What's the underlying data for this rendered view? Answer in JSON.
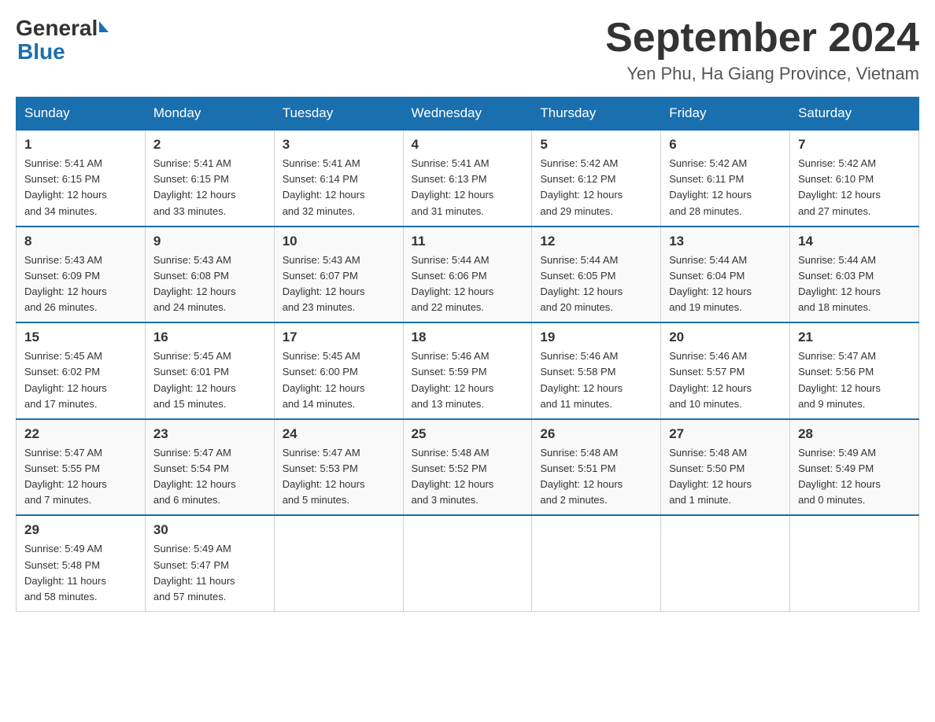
{
  "header": {
    "logo": {
      "general": "General",
      "blue": "Blue"
    },
    "title": "September 2024",
    "subtitle": "Yen Phu, Ha Giang Province, Vietnam"
  },
  "weekdays": [
    "Sunday",
    "Monday",
    "Tuesday",
    "Wednesday",
    "Thursday",
    "Friday",
    "Saturday"
  ],
  "weeks": [
    [
      {
        "day": "1",
        "sunrise": "5:41 AM",
        "sunset": "6:15 PM",
        "daylight": "12 hours and 34 minutes."
      },
      {
        "day": "2",
        "sunrise": "5:41 AM",
        "sunset": "6:15 PM",
        "daylight": "12 hours and 33 minutes."
      },
      {
        "day": "3",
        "sunrise": "5:41 AM",
        "sunset": "6:14 PM",
        "daylight": "12 hours and 32 minutes."
      },
      {
        "day": "4",
        "sunrise": "5:41 AM",
        "sunset": "6:13 PM",
        "daylight": "12 hours and 31 minutes."
      },
      {
        "day": "5",
        "sunrise": "5:42 AM",
        "sunset": "6:12 PM",
        "daylight": "12 hours and 29 minutes."
      },
      {
        "day": "6",
        "sunrise": "5:42 AM",
        "sunset": "6:11 PM",
        "daylight": "12 hours and 28 minutes."
      },
      {
        "day": "7",
        "sunrise": "5:42 AM",
        "sunset": "6:10 PM",
        "daylight": "12 hours and 27 minutes."
      }
    ],
    [
      {
        "day": "8",
        "sunrise": "5:43 AM",
        "sunset": "6:09 PM",
        "daylight": "12 hours and 26 minutes."
      },
      {
        "day": "9",
        "sunrise": "5:43 AM",
        "sunset": "6:08 PM",
        "daylight": "12 hours and 24 minutes."
      },
      {
        "day": "10",
        "sunrise": "5:43 AM",
        "sunset": "6:07 PM",
        "daylight": "12 hours and 23 minutes."
      },
      {
        "day": "11",
        "sunrise": "5:44 AM",
        "sunset": "6:06 PM",
        "daylight": "12 hours and 22 minutes."
      },
      {
        "day": "12",
        "sunrise": "5:44 AM",
        "sunset": "6:05 PM",
        "daylight": "12 hours and 20 minutes."
      },
      {
        "day": "13",
        "sunrise": "5:44 AM",
        "sunset": "6:04 PM",
        "daylight": "12 hours and 19 minutes."
      },
      {
        "day": "14",
        "sunrise": "5:44 AM",
        "sunset": "6:03 PM",
        "daylight": "12 hours and 18 minutes."
      }
    ],
    [
      {
        "day": "15",
        "sunrise": "5:45 AM",
        "sunset": "6:02 PM",
        "daylight": "12 hours and 17 minutes."
      },
      {
        "day": "16",
        "sunrise": "5:45 AM",
        "sunset": "6:01 PM",
        "daylight": "12 hours and 15 minutes."
      },
      {
        "day": "17",
        "sunrise": "5:45 AM",
        "sunset": "6:00 PM",
        "daylight": "12 hours and 14 minutes."
      },
      {
        "day": "18",
        "sunrise": "5:46 AM",
        "sunset": "5:59 PM",
        "daylight": "12 hours and 13 minutes."
      },
      {
        "day": "19",
        "sunrise": "5:46 AM",
        "sunset": "5:58 PM",
        "daylight": "12 hours and 11 minutes."
      },
      {
        "day": "20",
        "sunrise": "5:46 AM",
        "sunset": "5:57 PM",
        "daylight": "12 hours and 10 minutes."
      },
      {
        "day": "21",
        "sunrise": "5:47 AM",
        "sunset": "5:56 PM",
        "daylight": "12 hours and 9 minutes."
      }
    ],
    [
      {
        "day": "22",
        "sunrise": "5:47 AM",
        "sunset": "5:55 PM",
        "daylight": "12 hours and 7 minutes."
      },
      {
        "day": "23",
        "sunrise": "5:47 AM",
        "sunset": "5:54 PM",
        "daylight": "12 hours and 6 minutes."
      },
      {
        "day": "24",
        "sunrise": "5:47 AM",
        "sunset": "5:53 PM",
        "daylight": "12 hours and 5 minutes."
      },
      {
        "day": "25",
        "sunrise": "5:48 AM",
        "sunset": "5:52 PM",
        "daylight": "12 hours and 3 minutes."
      },
      {
        "day": "26",
        "sunrise": "5:48 AM",
        "sunset": "5:51 PM",
        "daylight": "12 hours and 2 minutes."
      },
      {
        "day": "27",
        "sunrise": "5:48 AM",
        "sunset": "5:50 PM",
        "daylight": "12 hours and 1 minute."
      },
      {
        "day": "28",
        "sunrise": "5:49 AM",
        "sunset": "5:49 PM",
        "daylight": "12 hours and 0 minutes."
      }
    ],
    [
      {
        "day": "29",
        "sunrise": "5:49 AM",
        "sunset": "5:48 PM",
        "daylight": "11 hours and 58 minutes."
      },
      {
        "day": "30",
        "sunrise": "5:49 AM",
        "sunset": "5:47 PM",
        "daylight": "11 hours and 57 minutes."
      },
      null,
      null,
      null,
      null,
      null
    ]
  ],
  "labels": {
    "sunrise": "Sunrise:",
    "sunset": "Sunset:",
    "daylight": "Daylight:"
  }
}
